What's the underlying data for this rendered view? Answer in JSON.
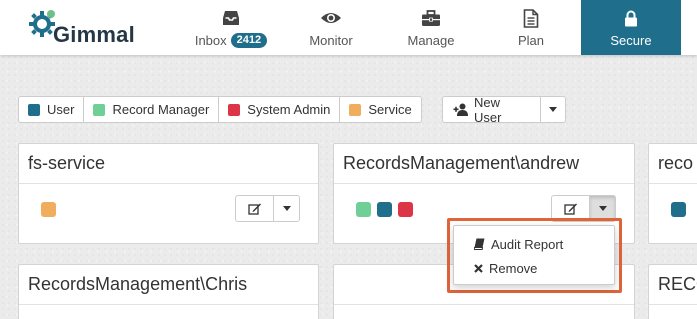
{
  "app": {
    "brand": "Gimmal"
  },
  "nav": {
    "items": [
      {
        "label": "Inbox",
        "icon": "inbox-icon",
        "badge": "2412"
      },
      {
        "label": "Monitor",
        "icon": "eye-icon"
      },
      {
        "label": "Manage",
        "icon": "briefcase-icon"
      },
      {
        "label": "Plan",
        "icon": "document-icon"
      },
      {
        "label": "Secure",
        "icon": "lock-icon",
        "active": true
      }
    ]
  },
  "legend": {
    "items": [
      {
        "label": "User",
        "color": "#1f6e8c"
      },
      {
        "label": "Record Manager",
        "color": "#6fcf97"
      },
      {
        "label": "System Admin",
        "color": "#dc3545"
      },
      {
        "label": "Service",
        "color": "#f0ad5e"
      }
    ]
  },
  "toolbar": {
    "new_user_label": "New User"
  },
  "cards": [
    {
      "title": "fs-service",
      "roles": [
        "#f0ad5e"
      ]
    },
    {
      "title": "RecordsManagement\\andrew",
      "roles": [
        "#6fcf97",
        "#1f6e8c",
        "#dc3545"
      ]
    },
    {
      "title": "reco",
      "roles": [
        "#dc3545",
        "#1f6e8c"
      ]
    },
    {
      "title": "RecordsManagement\\Chris",
      "roles": []
    },
    {
      "title": "",
      "roles": []
    },
    {
      "title": "RECO",
      "roles": []
    }
  ],
  "dropdown": {
    "items": [
      {
        "label": "Audit Report",
        "icon": "book-icon"
      },
      {
        "label": "Remove",
        "icon": "x-icon"
      }
    ]
  }
}
